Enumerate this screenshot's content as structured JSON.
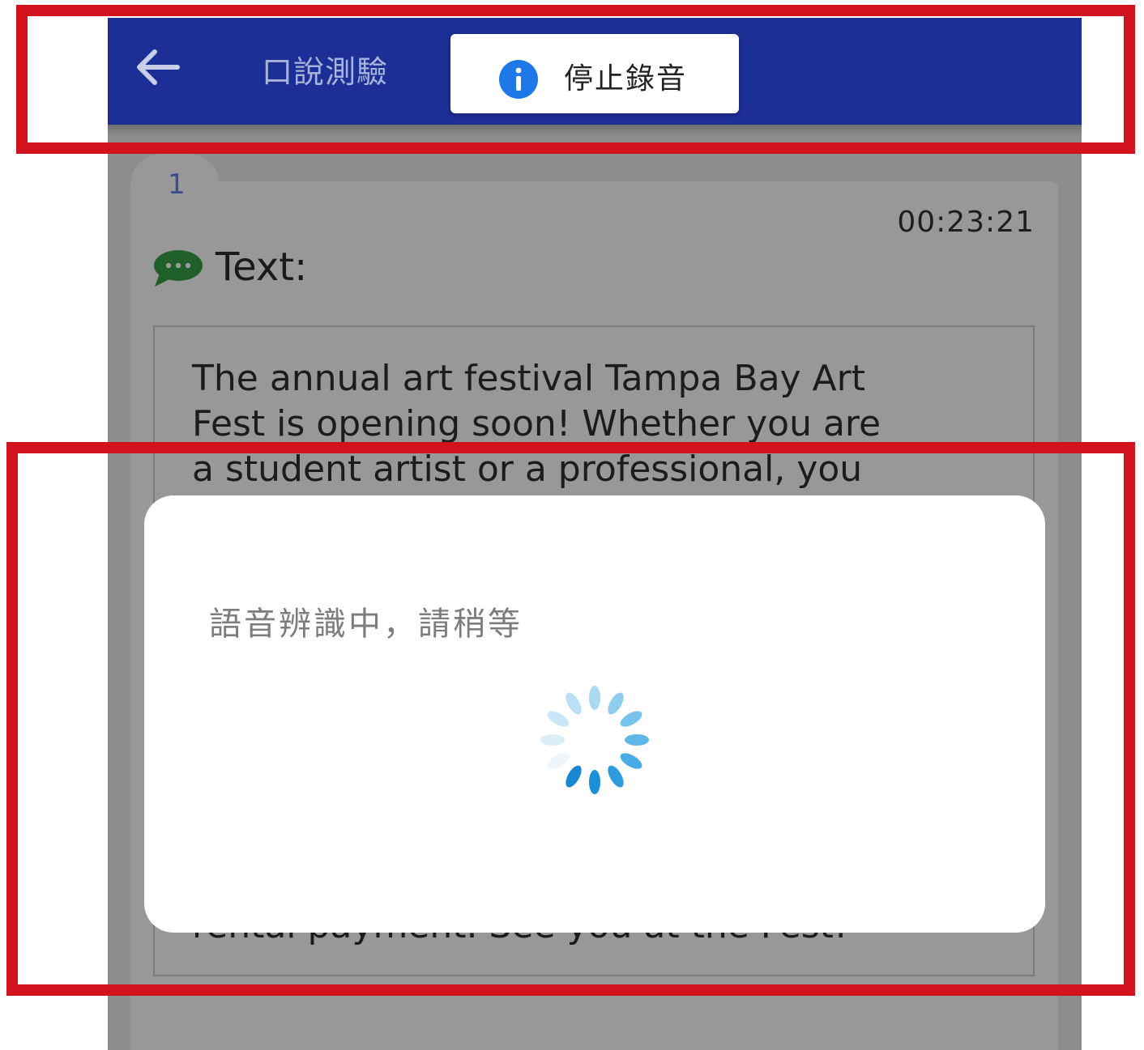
{
  "appbar": {
    "back_icon": "arrow-left-icon",
    "title": "口說測驗",
    "color": "#1b2f96"
  },
  "snackbar": {
    "icon": "info-icon",
    "label": "停止錄音"
  },
  "card": {
    "tab_number": "1",
    "timer": "00:23:21",
    "text_icon": "chat-bubble-icon",
    "text_label": "Text:",
    "passage_lines": [
      "The annual art festival Tampa Bay Art",
      "Fest is opening soon! Whether you are",
      "a student artist or a professional, you"
    ],
    "passage_tail": "rental payment. See you at the Fest!"
  },
  "dialog": {
    "message": "語音辨識中，請稍等",
    "spinner": "loading-spinner-icon"
  },
  "highlight_color": "#d0131d"
}
